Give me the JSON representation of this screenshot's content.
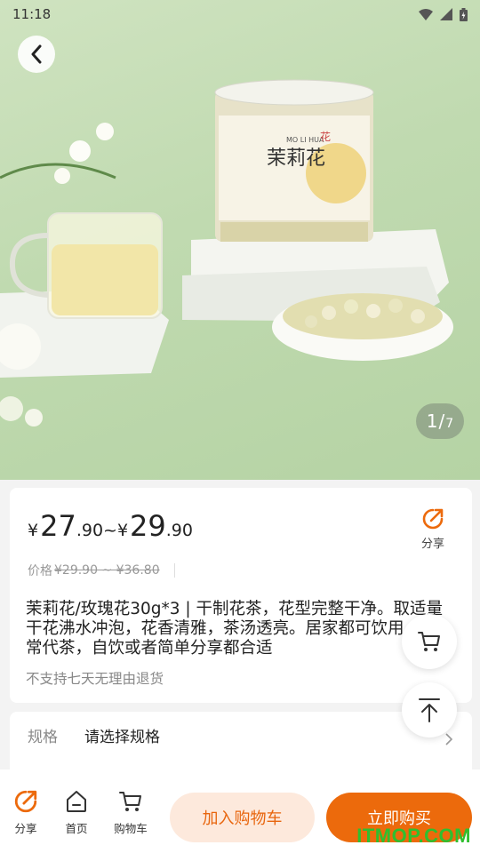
{
  "status": {
    "time": "11:18"
  },
  "gallery": {
    "current": "1",
    "total": "7",
    "jar_text": "茉莉花",
    "jar_pinyin": "MO LI HUA",
    "jar_stamp": "花",
    "background_color": "#c0dab0"
  },
  "price": {
    "currency": "¥",
    "low_int": "27",
    "low_dec": ".90",
    "range_sep": "~",
    "high_int": "29",
    "high_dec": ".90",
    "orig_label": "价格",
    "orig_values": "¥29.90 ~ ¥36.80"
  },
  "share": {
    "label": "分享"
  },
  "product": {
    "title": "茉莉花/玫瑰花30g*3 | 干制花茶，花型完整干净。取适量干花沸水冲泡，花香清雅，茶汤透亮。居家都可饮用，日常代茶，自饮或者简单分享都合适",
    "return_note": "不支持七天无理由退货"
  },
  "spec": {
    "label": "规格",
    "value": "请选择规格"
  },
  "bottom_nav": {
    "share": "分享",
    "home": "首页",
    "cart": "购物车",
    "add_to_cart": "加入购物车",
    "buy_now": "立即购买"
  },
  "watermark": "ITMOP.COM",
  "colors": {
    "accent": "#ec6a0c",
    "accent_light": "#fde9dc",
    "watermark": "#2fbf2f"
  }
}
